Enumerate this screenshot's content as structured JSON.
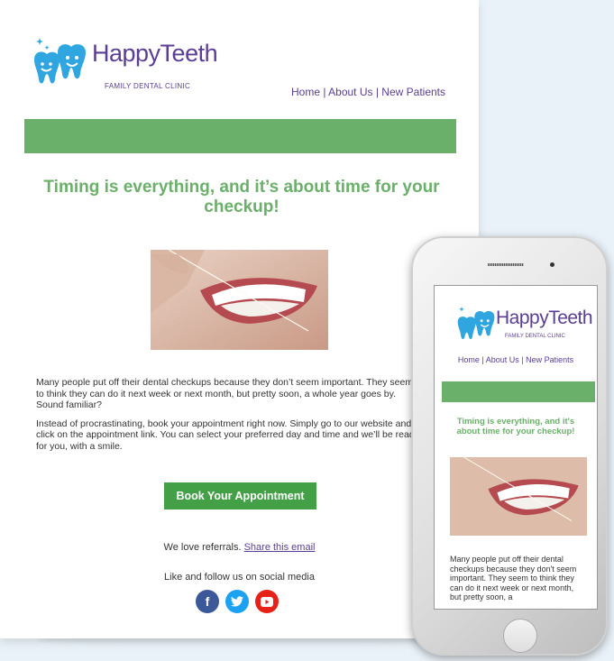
{
  "brand": {
    "name": "HappyTeeth",
    "subtitle": "FAMILY DENTAL CLINIC",
    "colors": {
      "purple": "#5a3e93",
      "green": "#6bb06a",
      "cta_green": "#43a047",
      "tooth_blue": "#2fa6df"
    }
  },
  "nav": {
    "items": [
      "Home",
      "About Us",
      "New Patients"
    ],
    "separator": " | "
  },
  "email": {
    "headline": "Timing is everything, and it’s about time for your checkup!",
    "paragraph_1": "Many people put off their dental checkups because they don’t seem important. They seem to think they can do it next week or next month, but pretty soon, a whole year goes by. Sound familiar?",
    "paragraph_2": "Instead of procrastinating, book your appointment right now. Simply go to our website and click on the appointment link. You can select your preferred day and time and we’ll be ready for you, with a smile.",
    "cta_label": "Book Your Appointment",
    "referral_text": "We love referrals.",
    "referral_link": "Share this email",
    "social_text": "Like and follow us on social media",
    "social_icons": [
      "facebook-icon",
      "twitter-icon",
      "youtube-icon"
    ]
  },
  "mobile": {
    "headline": "Timing is everything, and it's about time for your checkup!",
    "body_text": "Many people put off their dental checkups because they don't seem important. They seem to think they can do it next week or next month, but pretty soon, a"
  }
}
